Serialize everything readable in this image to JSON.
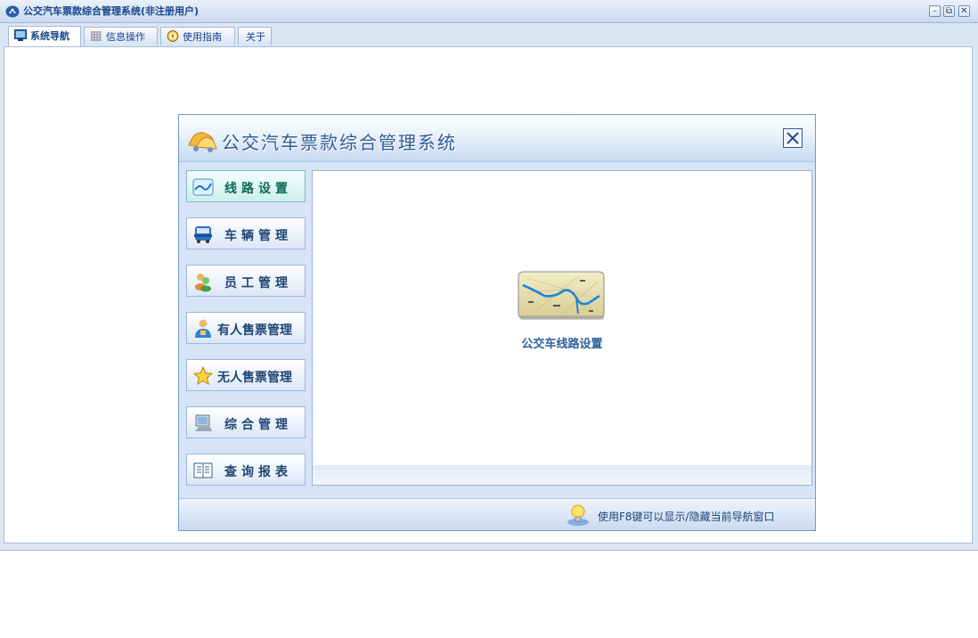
{
  "app": {
    "title": "公交汽车票款综合管理系统(非注册用户)",
    "buttons": {
      "minimize": "–",
      "restore": "⧉",
      "close": "✕"
    }
  },
  "menu": {
    "tabs": [
      {
        "label": "系统导航",
        "icon": "monitor-icon",
        "active": true
      },
      {
        "label": "信息操作",
        "icon": "grid-icon",
        "active": false
      },
      {
        "label": "使用指南",
        "icon": "compass-icon",
        "active": false
      },
      {
        "label": "关于",
        "icon": "",
        "active": false
      }
    ]
  },
  "nav_window": {
    "title": "公交汽车票款综合管理系统",
    "logo_icon": "bus-logo-icon",
    "close_icon": "close-icon",
    "sidebar": [
      {
        "label": "线路设置",
        "icon": "route-map-icon",
        "active": true
      },
      {
        "label": "车辆管理",
        "icon": "bus-icon",
        "active": false
      },
      {
        "label": "员工管理",
        "icon": "users-icon",
        "active": false
      },
      {
        "label": "有人售票管理",
        "icon": "conductor-icon",
        "active": false
      },
      {
        "label": "无人售票管理",
        "icon": "star-icon",
        "active": false
      },
      {
        "label": "综合管理",
        "icon": "computer-icon",
        "active": false
      },
      {
        "label": "查询报表",
        "icon": "report-icon",
        "active": false
      }
    ],
    "content": {
      "caption": "公交车线路设置",
      "thumbnail_icon": "route-map-thumbnail-icon"
    },
    "status": {
      "hint": "使用F8键可以显示/隐藏当前导航窗口",
      "hint_icon": "lightbulb-icon"
    }
  },
  "colors": {
    "accent": "#15428b",
    "title_blue": "#2f5c94",
    "active_green": "#0c6a58",
    "caption_blue": "#2a5f9a"
  }
}
